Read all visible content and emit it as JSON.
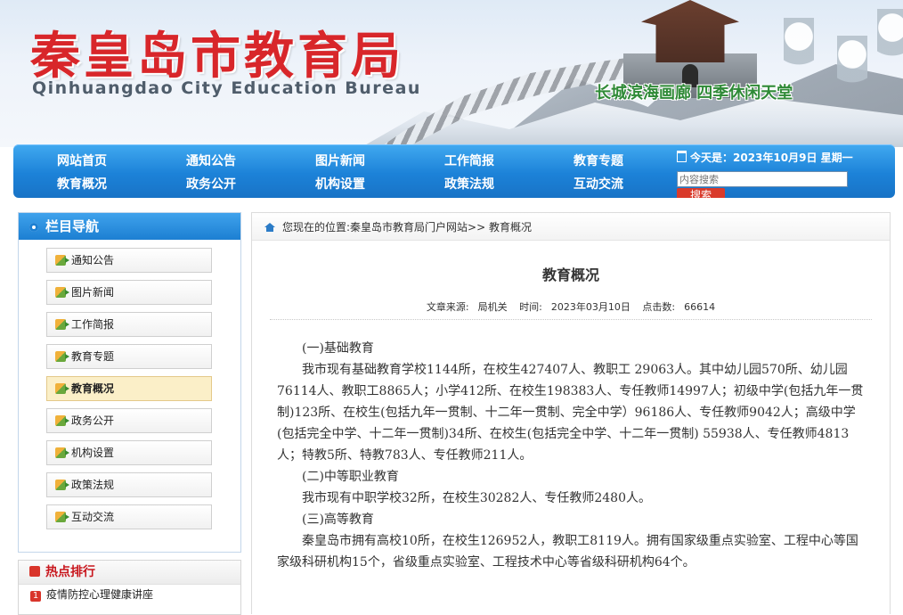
{
  "header": {
    "title_cn": "秦皇岛市教育局",
    "title_en": "Qinhuangdao City Education Bureau",
    "slogan": "长城滨海画廊 四季休闲天堂"
  },
  "nav": {
    "row1": [
      "网站首页",
      "通知公告",
      "图片新闻",
      "工作简报",
      "教育专题"
    ],
    "row2": [
      "教育概况",
      "政务公开",
      "机构设置",
      "政策法规",
      "互动交流"
    ],
    "date_text": "今天是：2023年10月9日 星期一",
    "search_placeholder": "内容搜索",
    "search_button": "搜索"
  },
  "sidebar": {
    "title": "栏目导航",
    "items": [
      "通知公告",
      "图片新闻",
      "工作简报",
      "教育专题",
      "教育概况",
      "政务公开",
      "机构设置",
      "政策法规",
      "互动交流"
    ],
    "active_index": 4
  },
  "hot": {
    "title": "热点排行",
    "items": [
      {
        "num": "1",
        "text": "疫情防控心理健康讲座"
      }
    ]
  },
  "breadcrumb": {
    "prefix": "您现在的位置:",
    "path": "秦皇岛市教育局门户网站>> 教育概况"
  },
  "article": {
    "title": "教育概况",
    "source_label": "文章来源:",
    "source": "局机关",
    "time_label": "时间:",
    "time": "2023年03月10日",
    "hits_label": "点击数:",
    "hits": "66614",
    "paragraphs": [
      "(一)基础教育",
      "我市现有基础教育学校1144所，在校生427407人、教职工 29063人。其中幼儿园570所、幼儿园76114人、教职工8865人；小学412所、在校生198383人、专任教师14997人；初级中学(包括九年一贯制)123所、在校生(包括九年一贯制、十二年一贯制、完全中学）96186人、专任教师9042人；高级中学(包括完全中学、十二年一贯制)34所、在校生(包括完全中学、十二年一贯制) 55938人、专任教师4813人；特教5所、特教783人、专任教师211人。",
      "(二)中等职业教育",
      "我市现有中职学校32所，在校生30282人、专任教师2480人。",
      "(三)高等教育",
      "秦皇岛市拥有高校10所，在校生126952人，教职工8119人。拥有国家级重点实验室、工程中心等国家级科研机构15个，省级重点实验室、工程技术中心等省级科研机构64个。"
    ]
  },
  "colors": {
    "title_red": "#d8262a",
    "nav_blue": "#1c82d8",
    "slogan_green": "#2f8a37",
    "hot_red": "#c8161d"
  }
}
